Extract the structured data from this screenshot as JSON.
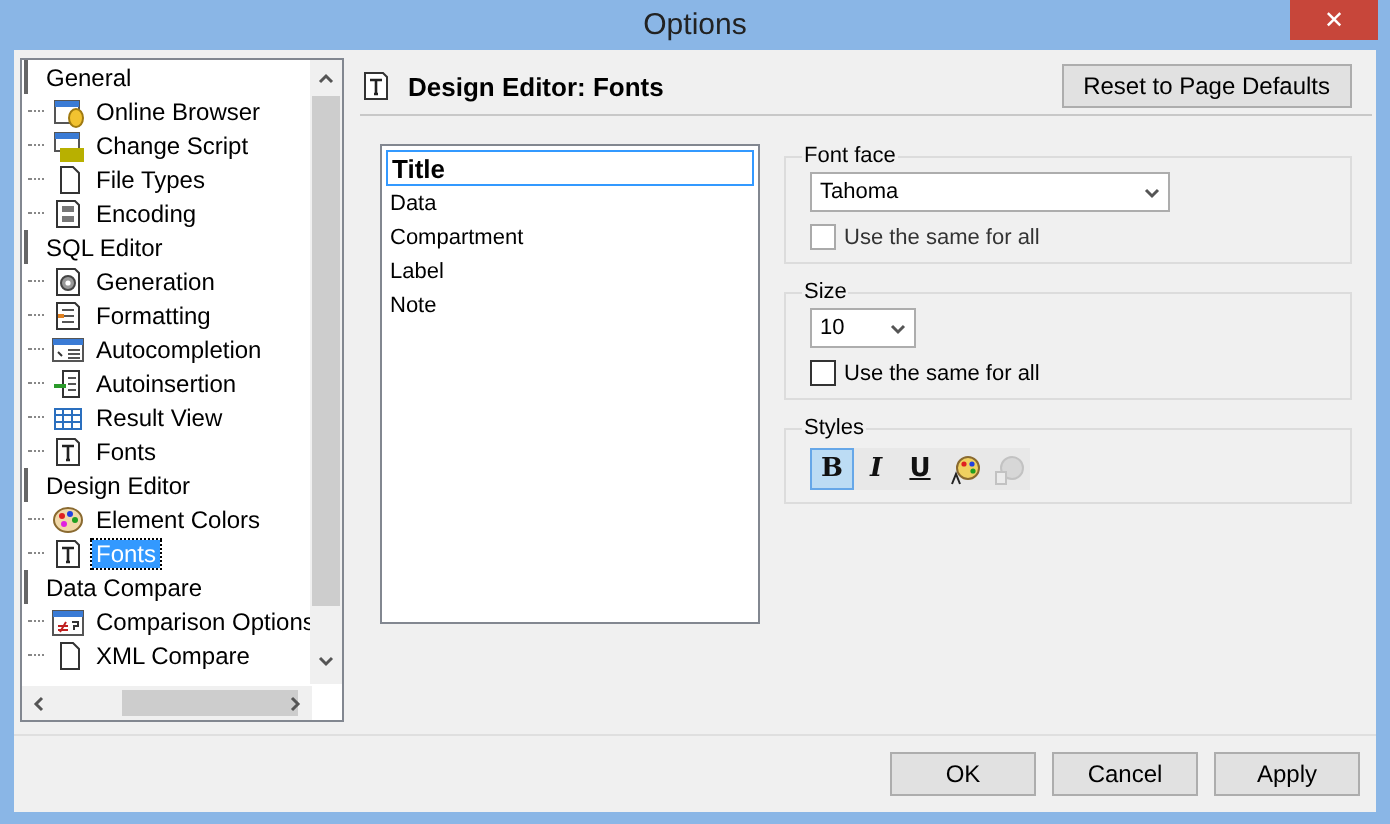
{
  "window": {
    "title": "Options",
    "close": "✕"
  },
  "sidebar": {
    "items": [
      {
        "label": "General",
        "children": [
          {
            "label": "Online Browser",
            "selected": false
          },
          {
            "label": "Change Script",
            "selected": false
          },
          {
            "label": "File Types",
            "selected": false
          },
          {
            "label": "Encoding",
            "selected": false
          }
        ]
      },
      {
        "label": "SQL Editor",
        "children": [
          {
            "label": "Generation",
            "selected": false
          },
          {
            "label": "Formatting",
            "selected": false
          },
          {
            "label": "Autocompletion",
            "selected": false
          },
          {
            "label": "Autoinsertion",
            "selected": false
          },
          {
            "label": "Result View",
            "selected": false
          },
          {
            "label": "Fonts",
            "selected": false
          }
        ]
      },
      {
        "label": "Design Editor",
        "children": [
          {
            "label": "Element Colors",
            "selected": false
          },
          {
            "label": "Fonts",
            "selected": true
          }
        ]
      },
      {
        "label": "Data Compare",
        "children": [
          {
            "label": "Comparison Options",
            "selected": false
          },
          {
            "label": "XML Compare",
            "selected": false
          }
        ]
      }
    ]
  },
  "header": {
    "title": "Design Editor: Fonts",
    "reset_button": "Reset to Page Defaults"
  },
  "elements": [
    {
      "label": "Title",
      "selected": true
    },
    {
      "label": "Data",
      "selected": false
    },
    {
      "label": "Compartment",
      "selected": false
    },
    {
      "label": "Label",
      "selected": false
    },
    {
      "label": "Note",
      "selected": false
    }
  ],
  "font_face": {
    "legend": "Font face",
    "value": "Tahoma",
    "same_for_all": {
      "label": "Use the same for all",
      "checked": false,
      "disabled": true
    }
  },
  "size": {
    "legend": "Size",
    "value": "10",
    "same_for_all": {
      "label": "Use the same for all",
      "checked": false,
      "disabled": false
    }
  },
  "styles": {
    "legend": "Styles",
    "buttons": [
      {
        "kind": "bold",
        "label": "B",
        "selected": true
      },
      {
        "kind": "italic",
        "label": "I",
        "selected": false
      },
      {
        "kind": "underline",
        "label": "U",
        "selected": false
      },
      {
        "kind": "color",
        "selected": false
      },
      {
        "kind": "background",
        "selected": false,
        "disabled": true
      }
    ]
  },
  "buttons": [
    "OK",
    "Cancel",
    "Apply"
  ]
}
